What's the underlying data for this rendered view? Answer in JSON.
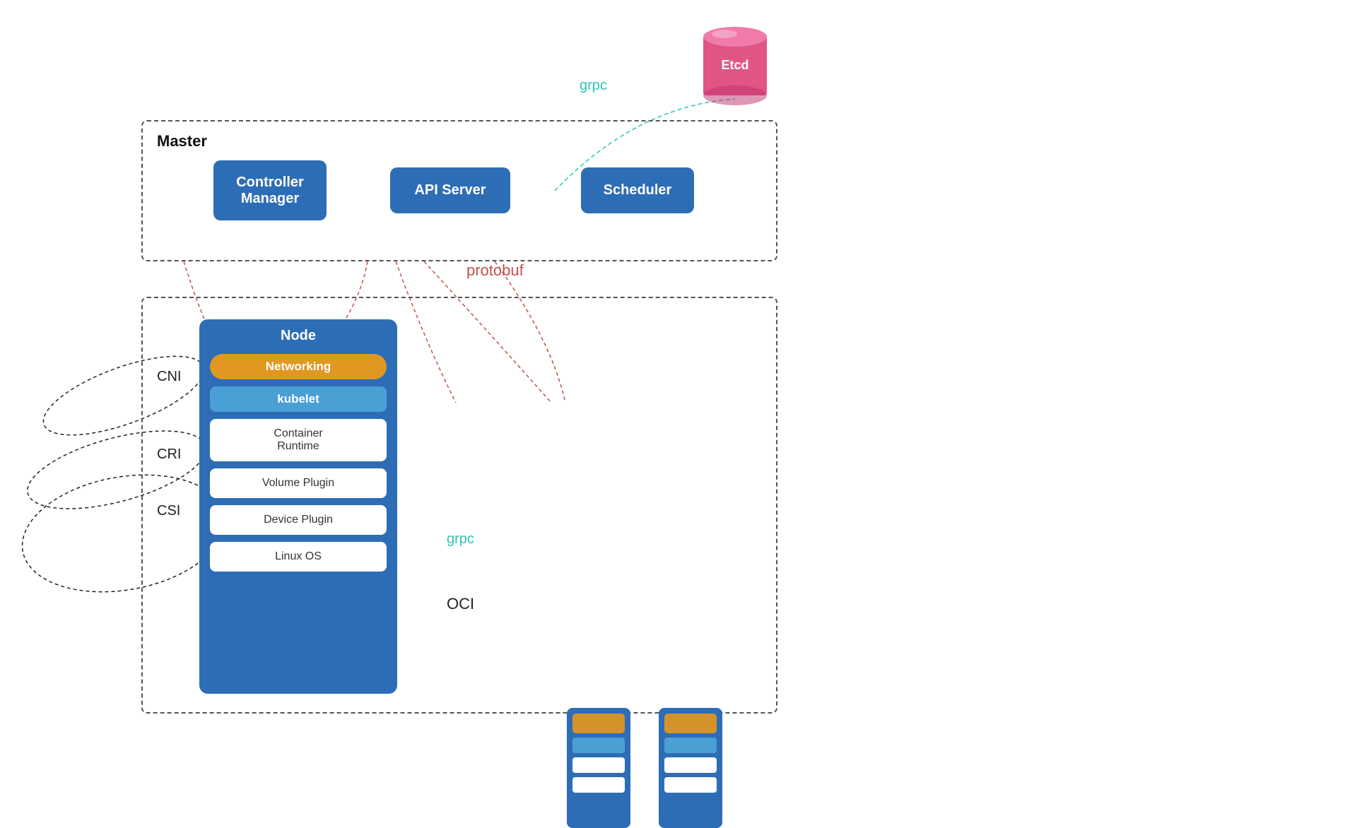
{
  "etcd": {
    "label": "Etcd",
    "color": "#e05585",
    "grpc_label": "grpc"
  },
  "master": {
    "label": "Master",
    "controller_manager": "Controller\nManager",
    "api_server": "API Server",
    "scheduler": "Scheduler"
  },
  "node": {
    "label": "Node",
    "networking": "Networking",
    "kubelet": "kubelet",
    "container_runtime": "Container\nRuntime",
    "volume_plugin": "Volume Plugin",
    "device_plugin": "Device Plugin",
    "linux_os": "Linux OS"
  },
  "labels": {
    "cni": "CNI",
    "cri": "CRI",
    "csi": "CSI",
    "oci": "OCI",
    "grpc_node": "grpc",
    "protobuf": "protobuf",
    "grpc_etcd": "grpc"
  }
}
